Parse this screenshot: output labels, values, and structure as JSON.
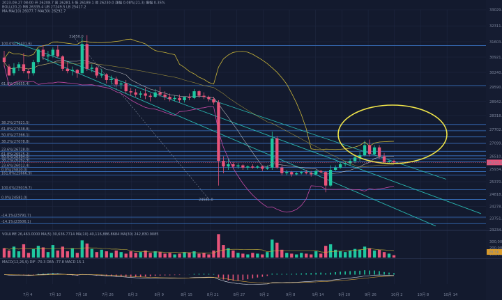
{
  "chart_data": {
    "type": "candlestick",
    "header": {
      "time_line": "2023-09-27 08:00",
      "ohlc": [
        "开 26208.7",
        "高 26281.5",
        "低 26189.1",
        "收 26230.0",
        "涨幅 0.08%(21.3)",
        "振幅 0.35%"
      ],
      "boll_label": "BOLL(20,2)",
      "boll_mid": "MB 26335.4",
      "boll_up": "UB 27249.5",
      "boll_low": "LB 25417.2",
      "ma_label": "MA",
      "ma10": "MA(10) 26077.7",
      "ma30": "MA(30) 26292.7"
    },
    "price_axis": [
      "33029.7",
      "32311.0",
      "31603.9",
      "30921.5",
      "30240.9",
      "29590.7",
      "28942.3",
      "28318.7",
      "27702.3",
      "27099.9",
      "26510.7",
      "25934.3",
      "25370.2",
      "24818.0",
      "24278.9",
      "23751.5",
      "23234.3"
    ],
    "current_price_tag": "26230.0",
    "time_axis": [
      "7月 4",
      "7月 10",
      "7月 18",
      "7月 26",
      "8月 3",
      "8月 9",
      "8月 15",
      "8月 21",
      "8月 27",
      "9月 2",
      "9月 8",
      "9月 14",
      "9月 20",
      "9月 26",
      "10月 2",
      "10月 8",
      "10月 14"
    ],
    "fib_levels": [
      "100.0%(31431.6)",
      "61.8%(29655.4)",
      "38.2%(27921.5)",
      "61.8%(27638.8)",
      "50.0%(27366.1)",
      "38.2%(27078.8)",
      "23.6%(26728.0)",
      "61.8%(26525.2)",
      "50.0%(26394.0)",
      "38.2%(26262.9)",
      "23.6%(26012.4)",
      "0.0%(25820.0)",
      "161.8%(25666.9)",
      "100.0%(25019.7)",
      "0.0%(24581.0)",
      "-14.1%(23791.7)",
      "-14.1%(23506.1)"
    ],
    "annotations": {
      "high_marker": "31850.0",
      "low_marker": "24581.0"
    },
    "volume_header": [
      "VOLUME",
      "26,463.0000",
      "MA(5) 30,636.7714",
      "MA(10) 40,116,886.8684",
      "MA(30) 242,830.9085"
    ],
    "volume_axis": [
      "300,000",
      "200,000",
      "100,000"
    ],
    "volume_tag": "28.5K",
    "macd_header": [
      "MACD(12,26,9)",
      "DIF -70.3",
      "DEA -77.8",
      "MACD 15.1"
    ],
    "candles": [
      [
        30900,
        31200,
        30700,
        30500
      ],
      [
        30500,
        30600,
        30100,
        30200
      ],
      [
        30200,
        30650,
        30450,
        30100
      ],
      [
        30450,
        30700,
        30600,
        30300
      ],
      [
        30600,
        31100,
        30300,
        30200
      ],
      [
        30300,
        30400,
        30200,
        29950
      ],
      [
        30200,
        30800,
        30700,
        30100
      ],
      [
        30700,
        31300,
        31250,
        30600
      ],
      [
        31250,
        31450,
        30950,
        30800
      ],
      [
        30950,
        31200,
        31000,
        30700
      ],
      [
        31000,
        31350,
        31250,
        30900
      ],
      [
        31250,
        31450,
        30950,
        30900
      ],
      [
        30950,
        31000,
        30400,
        30300
      ],
      [
        30400,
        30700,
        30300,
        30200
      ],
      [
        30300,
        30500,
        30350,
        30100
      ],
      [
        30350,
        30400,
        30200,
        30000
      ],
      [
        30200,
        31800,
        31500,
        30200
      ],
      [
        31500,
        31900,
        30400,
        30300
      ],
      [
        30400,
        30600,
        30450,
        30250
      ],
      [
        30450,
        30500,
        30100,
        30000
      ],
      [
        30100,
        30400,
        30150,
        30000
      ],
      [
        30150,
        30200,
        29900,
        29750
      ],
      [
        29900,
        30100,
        29950,
        29700
      ],
      [
        29950,
        30050,
        29700,
        29600
      ],
      [
        29700,
        29850,
        29750,
        29500
      ],
      [
        29750,
        29900,
        29400,
        29300
      ],
      [
        29400,
        29550,
        29350,
        29200
      ],
      [
        29350,
        29500,
        29250,
        29150
      ],
      [
        29250,
        29400,
        29300,
        29100
      ],
      [
        29300,
        29550,
        29200,
        29050
      ],
      [
        29200,
        29300,
        29150,
        28950
      ],
      [
        29150,
        29500,
        29350,
        29100
      ],
      [
        29350,
        29600,
        29250,
        29150
      ],
      [
        29250,
        29400,
        29150,
        29000
      ],
      [
        29150,
        29300,
        29050,
        28950
      ],
      [
        29050,
        29200,
        29100,
        28950
      ],
      [
        29100,
        29250,
        29000,
        28900
      ],
      [
        29000,
        29100,
        29150,
        28900
      ],
      [
        29150,
        29300,
        29100,
        29000
      ],
      [
        29100,
        29500,
        29400,
        29050
      ],
      [
        29400,
        29450,
        29200,
        29100
      ],
      [
        29200,
        29350,
        29150,
        29050
      ],
      [
        29150,
        29200,
        29050,
        28950
      ],
      [
        29050,
        29150,
        28900,
        28800
      ],
      [
        28900,
        29000,
        26300,
        25200
      ],
      [
        26300,
        26500,
        26050,
        25750
      ],
      [
        26050,
        26400,
        26150,
        25900
      ],
      [
        26150,
        26250,
        26050,
        25950
      ],
      [
        26050,
        26200,
        26100,
        25950
      ],
      [
        26100,
        26150,
        26000,
        25900
      ],
      [
        26000,
        26100,
        26050,
        25900
      ],
      [
        26050,
        26150,
        26000,
        25950
      ],
      [
        26000,
        26100,
        26050,
        25950
      ],
      [
        26050,
        26100,
        25950,
        25850
      ],
      [
        25950,
        26100,
        26000,
        25900
      ],
      [
        26000,
        27600,
        27300,
        25900
      ],
      [
        27300,
        27400,
        26000,
        25950
      ],
      [
        26000,
        26100,
        25750,
        25650
      ],
      [
        25750,
        25900,
        25800,
        25650
      ],
      [
        25800,
        25850,
        25700,
        25600
      ],
      [
        25700,
        25800,
        25750,
        25650
      ],
      [
        25750,
        25850,
        25800,
        25700
      ],
      [
        25800,
        25900,
        25750,
        25700
      ],
      [
        25750,
        25850,
        25700,
        25600
      ],
      [
        25700,
        25900,
        25850,
        25650
      ],
      [
        25850,
        25900,
        25800,
        25750
      ],
      [
        25800,
        25850,
        25200,
        24900
      ],
      [
        25200,
        26100,
        25900,
        25150
      ],
      [
        25900,
        26100,
        26000,
        25850
      ],
      [
        26000,
        26250,
        26150,
        25950
      ],
      [
        26150,
        26300,
        26200,
        26050
      ],
      [
        26200,
        26400,
        26300,
        26100
      ],
      [
        26300,
        26550,
        26450,
        26200
      ],
      [
        26450,
        26700,
        26550,
        26300
      ],
      [
        26550,
        27200,
        27000,
        26500
      ],
      [
        27000,
        27250,
        26600,
        26500
      ],
      [
        26600,
        27000,
        26900,
        26550
      ],
      [
        26900,
        27000,
        26500,
        26400
      ],
      [
        26500,
        26650,
        26250,
        26200
      ],
      [
        26250,
        26350,
        26300,
        26200
      ],
      [
        26300,
        26350,
        26230,
        26190
      ]
    ],
    "volumes": [
      120,
      90,
      140,
      80,
      170,
      60,
      110,
      150,
      130,
      70,
      160,
      90,
      140,
      80,
      120,
      60,
      220,
      180,
      110,
      70,
      100,
      80,
      60,
      90,
      70,
      50,
      80,
      60,
      70,
      90,
      60,
      80,
      70,
      50,
      60,
      40,
      50,
      70,
      60,
      80,
      50,
      60,
      40,
      90,
      300,
      160,
      120,
      90,
      60,
      50,
      40,
      60,
      50,
      40,
      70,
      230,
      190,
      100,
      60,
      50,
      40,
      60,
      50,
      40,
      80,
      50,
      150,
      170,
      100,
      80,
      70,
      90,
      110,
      100,
      140,
      120,
      90,
      100,
      70,
      50,
      30
    ],
    "ylim": [
      23234.3,
      33029.7
    ]
  }
}
